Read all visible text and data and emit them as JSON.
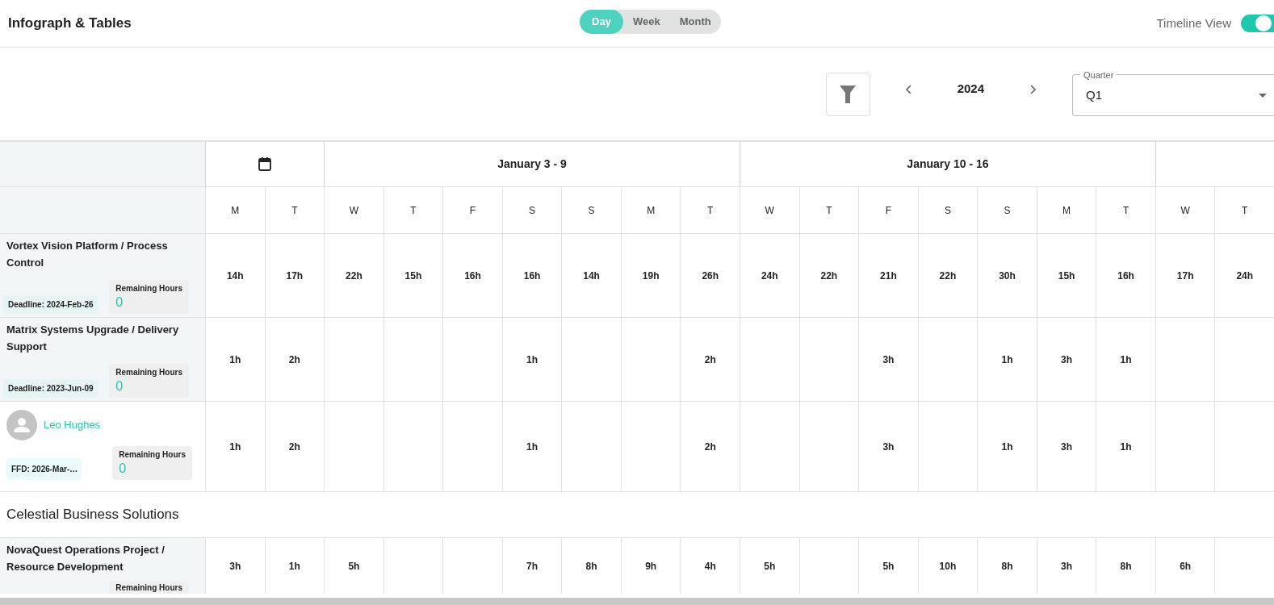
{
  "header": {
    "title": "Infograph & Tables",
    "view_modes": [
      {
        "label": "Day",
        "selected": true
      },
      {
        "label": "Week",
        "selected": false
      },
      {
        "label": "Month",
        "selected": false
      }
    ],
    "timeline_toggle": {
      "label": "Timeline View",
      "on": true
    }
  },
  "toolbar": {
    "year": "2024",
    "quarter": {
      "label": "Quarter",
      "value": "Q1"
    }
  },
  "weeks": [
    {
      "kind": "calendar"
    },
    {
      "kind": "week",
      "label": "January 3 - 9"
    },
    {
      "kind": "week",
      "label": "January 10 - 16"
    },
    {
      "kind": "partial_week"
    }
  ],
  "days": [
    "M",
    "T",
    "W",
    "T",
    "F",
    "S",
    "S",
    "M",
    "T",
    "W",
    "T",
    "F",
    "S",
    "S",
    "M",
    "T",
    "W",
    "T"
  ],
  "rows": [
    {
      "kind": "project",
      "title": "Vortex Vision Platform / Process Control",
      "tag": "Deadline: 2024-Feb-26",
      "remaining_label": "Remaining Hours",
      "remaining": "0",
      "cells": [
        {
          "kind": "hours",
          "value": "14h"
        },
        {
          "kind": "hours",
          "value": "17h"
        },
        {
          "kind": "hours",
          "value": "22h"
        },
        {
          "kind": "hours",
          "value": "15h"
        },
        {
          "kind": "hours",
          "value": "16h"
        },
        {
          "kind": "hours",
          "value": "16h"
        },
        {
          "kind": "hours",
          "value": "14h"
        },
        {
          "kind": "hours",
          "value": "19h"
        },
        {
          "kind": "hours",
          "value": "26h"
        },
        {
          "kind": "hours",
          "value": "24h"
        },
        {
          "kind": "hours",
          "value": "22h"
        },
        {
          "kind": "hours",
          "value": "21h"
        },
        {
          "kind": "hours",
          "value": "22h"
        },
        {
          "kind": "hours",
          "value": "30h"
        },
        {
          "kind": "hours",
          "value": "15h"
        },
        {
          "kind": "hours",
          "value": "16h"
        },
        {
          "kind": "hours",
          "value": "17h"
        },
        {
          "kind": "hours",
          "value": "24h"
        }
      ]
    },
    {
      "kind": "project",
      "title": "Matrix Systems Upgrade / Delivery Support",
      "tag": "Deadline: 2023-Jun-09",
      "remaining_label": "Remaining Hours",
      "remaining": "0",
      "cells": [
        {
          "kind": "hours",
          "value": "1h"
        },
        {
          "kind": "hours",
          "value": "2h"
        },
        {
          "kind": "empty"
        },
        {
          "kind": "empty"
        },
        {
          "kind": "empty"
        },
        {
          "kind": "hours",
          "value": "1h"
        },
        {
          "kind": "empty"
        },
        {
          "kind": "empty"
        },
        {
          "kind": "hours",
          "value": "2h"
        },
        {
          "kind": "empty"
        },
        {
          "kind": "empty"
        },
        {
          "kind": "hours",
          "value": "3h"
        },
        {
          "kind": "empty"
        },
        {
          "kind": "hours",
          "value": "1h"
        },
        {
          "kind": "hours",
          "value": "3h"
        },
        {
          "kind": "hours",
          "value": "1h"
        },
        {
          "kind": "empty"
        },
        {
          "kind": "empty"
        }
      ]
    },
    {
      "kind": "person",
      "name": "Leo Hughes",
      "tag": "FFD: 2026-Mar-…",
      "remaining_label": "Remaining Hours",
      "remaining": "0",
      "cells": [
        {
          "kind": "hours",
          "value": "1h"
        },
        {
          "kind": "hours",
          "value": "2h"
        },
        {
          "kind": "empty"
        },
        {
          "kind": "empty"
        },
        {
          "kind": "empty"
        },
        {
          "kind": "hours",
          "value": "1h"
        },
        {
          "kind": "empty"
        },
        {
          "kind": "empty"
        },
        {
          "kind": "hours",
          "value": "2h"
        },
        {
          "kind": "empty"
        },
        {
          "kind": "empty"
        },
        {
          "kind": "hours",
          "value": "3h"
        },
        {
          "kind": "empty"
        },
        {
          "kind": "hours",
          "value": "1h"
        },
        {
          "kind": "hours",
          "value": "3h"
        },
        {
          "kind": "hours",
          "value": "1h"
        },
        {
          "kind": "empty"
        },
        {
          "kind": "empty"
        }
      ]
    },
    {
      "kind": "group",
      "title": "Celestial Business Solutions"
    },
    {
      "kind": "project_cut",
      "title": "NovaQuest Operations Project / Resource Development",
      "remaining_label": "Remaining Hours",
      "cells": [
        {
          "kind": "hours",
          "value": "3h"
        },
        {
          "kind": "hours",
          "value": "1h"
        },
        {
          "kind": "hours",
          "value": "5h"
        },
        {
          "kind": "empty"
        },
        {
          "kind": "empty"
        },
        {
          "kind": "hours",
          "value": "7h"
        },
        {
          "kind": "hours",
          "value": "8h"
        },
        {
          "kind": "hours",
          "value": "9h"
        },
        {
          "kind": "hours",
          "value": "4h"
        },
        {
          "kind": "hours",
          "value": "5h"
        },
        {
          "kind": "empty"
        },
        {
          "kind": "hours",
          "value": "5h"
        },
        {
          "kind": "hours",
          "value": "10h"
        },
        {
          "kind": "hours",
          "value": "8h"
        },
        {
          "kind": "hours",
          "value": "3h"
        },
        {
          "kind": "hours",
          "value": "8h"
        },
        {
          "kind": "hours",
          "value": "6h"
        },
        {
          "kind": "empty"
        }
      ]
    }
  ]
}
